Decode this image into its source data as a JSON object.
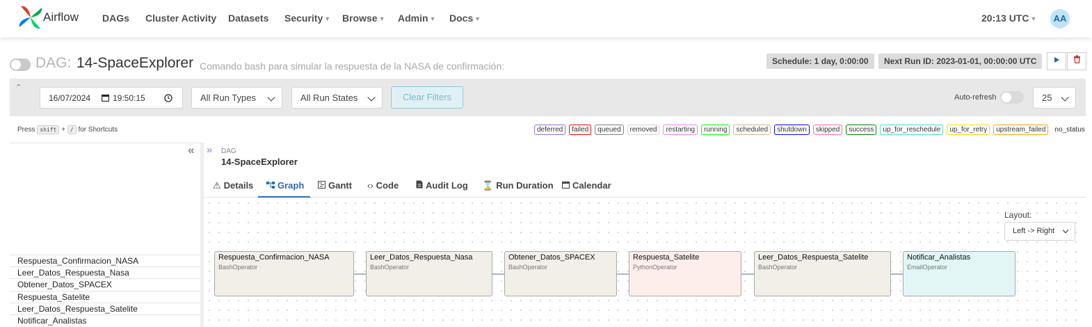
{
  "navbar": {
    "brand": "Airflow",
    "items": [
      {
        "label": "DAGs",
        "dropdown": false
      },
      {
        "label": "Cluster Activity",
        "dropdown": false
      },
      {
        "label": "Datasets",
        "dropdown": false
      },
      {
        "label": "Security",
        "dropdown": true
      },
      {
        "label": "Browse",
        "dropdown": true
      },
      {
        "label": "Admin",
        "dropdown": true
      },
      {
        "label": "Docs",
        "dropdown": true
      }
    ],
    "clock": "20:13 UTC",
    "avatar": "AA"
  },
  "dag": {
    "prefix": "DAG:",
    "id": "14-SpaceExplorer",
    "description": "Comando bash para simular la respuesta de la NASA de confirmación:",
    "schedule": "Schedule: 1 day, 0:00:00",
    "next_run": "Next Run ID: 2023-01-01, 00:00:00 UTC"
  },
  "filters": {
    "date": "16/07/2024",
    "time": "19:50:15",
    "run_types": "All Run Types",
    "run_states": "All Run States",
    "clear_label": "Clear Filters",
    "auto_refresh_label": "Auto-refresh",
    "page_size": "25"
  },
  "shortcut": {
    "press": "Press",
    "key1": "shift",
    "plus": "+",
    "key2": "/",
    "suffix": "for Shortcuts"
  },
  "states": [
    {
      "label": "deferred",
      "color": "#9370db"
    },
    {
      "label": "failed",
      "color": "#ff0000"
    },
    {
      "label": "queued",
      "color": "#808080"
    },
    {
      "label": "removed",
      "color": "#d3d3d3"
    },
    {
      "label": "restarting",
      "color": "#ee82ee"
    },
    {
      "label": "running",
      "color": "#00ff00"
    },
    {
      "label": "scheduled",
      "color": "#d2b48c"
    },
    {
      "label": "shutdown",
      "color": "#0000ff"
    },
    {
      "label": "skipped",
      "color": "#ff69b4"
    },
    {
      "label": "success",
      "color": "#008000"
    },
    {
      "label": "up_for_reschedule",
      "color": "#40e0d0"
    },
    {
      "label": "up_for_retry",
      "color": "#ffd700"
    },
    {
      "label": "upstream_failed",
      "color": "#ffa500"
    },
    {
      "label": "no_status",
      "color": "#ffffff"
    }
  ],
  "tasks": [
    "Respuesta_Confirmacion_NASA",
    "Leer_Datos_Respuesta_Nasa",
    "Obtener_Datos_SPACEX",
    "Respuesta_Satelite",
    "Leer_Datos_Respuesta_Satelite",
    "Notificar_Analistas"
  ],
  "detail": {
    "crumb_label": "DAG",
    "crumb_dag": "14-SpaceExplorer",
    "tabs": [
      {
        "label": "Details",
        "icon": "warning-triangle-icon",
        "active": false
      },
      {
        "label": "Graph",
        "icon": "graph-icon",
        "active": true
      },
      {
        "label": "Gantt",
        "icon": "gantt-icon",
        "active": false
      },
      {
        "label": "Code",
        "icon": "code-icon",
        "active": false
      },
      {
        "label": "Audit Log",
        "icon": "audit-log-icon",
        "active": false
      },
      {
        "label": "Run Duration",
        "icon": "hourglass-icon",
        "active": false
      },
      {
        "label": "Calendar",
        "icon": "calendar-icon",
        "active": false
      }
    ]
  },
  "graph": {
    "layout_label": "Layout:",
    "layout_value": "Left -> Right",
    "nodes": [
      {
        "name": "Respuesta_Confirmacion_NASA",
        "operator": "BashOperator",
        "color": "#f2eee8"
      },
      {
        "name": "Leer_Datos_Respuesta_Nasa",
        "operator": "BashOperator",
        "color": "#f2eee8"
      },
      {
        "name": "Obtener_Datos_SPACEX",
        "operator": "BashOperator",
        "color": "#f2eee8"
      },
      {
        "name": "Respuesta_Satelite",
        "operator": "PythonOperator",
        "color": "#fdeeec"
      },
      {
        "name": "Leer_Datos_Respuesta_Satelite",
        "operator": "BashOperator",
        "color": "#f2eee8"
      },
      {
        "name": "Notificar_Analistas",
        "operator": "EmailOperator",
        "color": "#e2f6f6"
      }
    ]
  }
}
